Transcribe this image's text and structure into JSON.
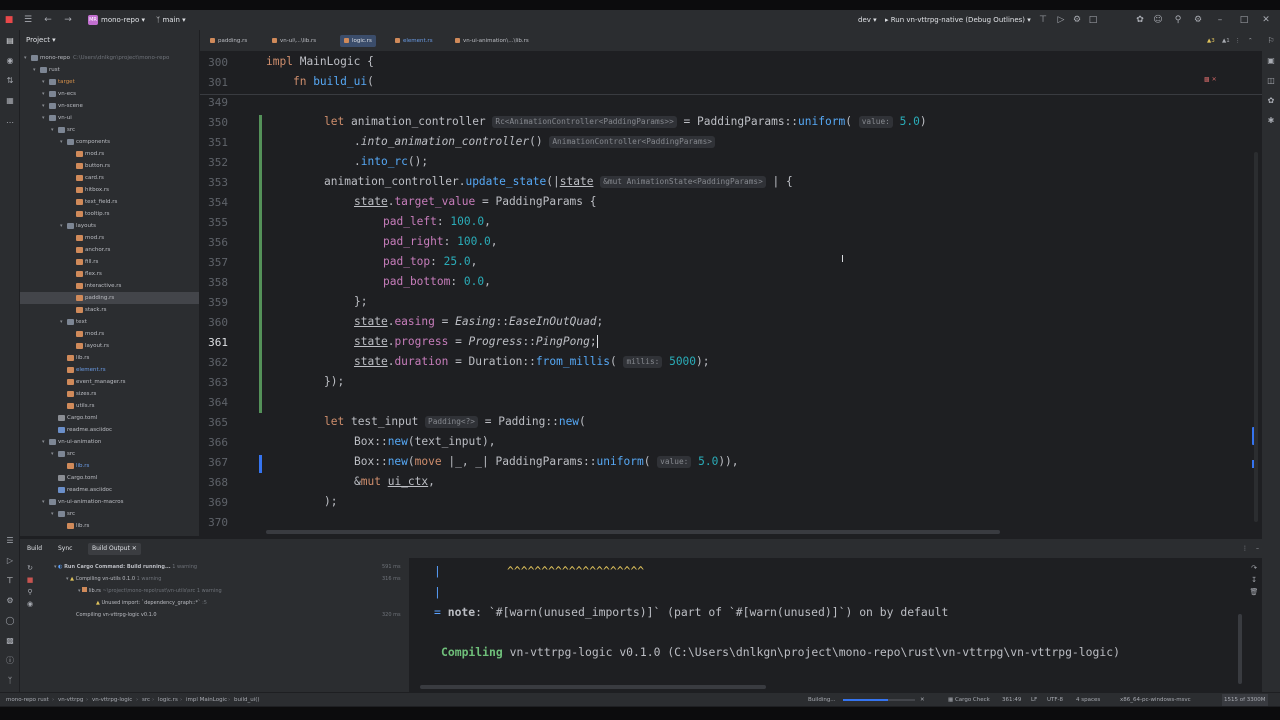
{
  "titlebar": {
    "project_badge": "MR",
    "project_name": "mono-repo",
    "branch": "main",
    "profile": "dev",
    "run_config": "Run vn-vttrpg-native (Debug Outlines)"
  },
  "project_panel": {
    "title": "Project",
    "rows": [
      {
        "label": "mono-repo",
        "path": "C:\\Users\\dnlkgn\\project\\mono-repo",
        "depth": 0,
        "kind": "folder",
        "style": ""
      },
      {
        "label": "rust",
        "depth": 1,
        "kind": "folder",
        "style": ""
      },
      {
        "label": "target",
        "depth": 2,
        "kind": "folder",
        "style": "orange"
      },
      {
        "label": "vn-ecs",
        "depth": 2,
        "kind": "folder",
        "style": ""
      },
      {
        "label": "vn-scene",
        "depth": 2,
        "kind": "folder",
        "style": ""
      },
      {
        "label": "vn-ui",
        "depth": 2,
        "kind": "folder",
        "style": ""
      },
      {
        "label": "src",
        "depth": 3,
        "kind": "folder",
        "style": ""
      },
      {
        "label": "components",
        "depth": 4,
        "kind": "folder",
        "style": ""
      },
      {
        "label": "mod.rs",
        "depth": 5,
        "kind": "rs",
        "style": ""
      },
      {
        "label": "button.rs",
        "depth": 5,
        "kind": "rs",
        "style": ""
      },
      {
        "label": "card.rs",
        "depth": 5,
        "kind": "rs",
        "style": ""
      },
      {
        "label": "hitbox.rs",
        "depth": 5,
        "kind": "rs",
        "style": ""
      },
      {
        "label": "text_field.rs",
        "depth": 5,
        "kind": "rs",
        "style": ""
      },
      {
        "label": "tooltip.rs",
        "depth": 5,
        "kind": "rs",
        "style": ""
      },
      {
        "label": "layouts",
        "depth": 4,
        "kind": "folder",
        "style": ""
      },
      {
        "label": "mod.rs",
        "depth": 5,
        "kind": "rs",
        "style": ""
      },
      {
        "label": "anchor.rs",
        "depth": 5,
        "kind": "rs",
        "style": ""
      },
      {
        "label": "fill.rs",
        "depth": 5,
        "kind": "rs",
        "style": ""
      },
      {
        "label": "flex.rs",
        "depth": 5,
        "kind": "rs",
        "style": ""
      },
      {
        "label": "interactive.rs",
        "depth": 5,
        "kind": "rs",
        "style": ""
      },
      {
        "label": "padding.rs",
        "depth": 5,
        "kind": "rs",
        "style": "sel"
      },
      {
        "label": "stack.rs",
        "depth": 5,
        "kind": "rs",
        "style": ""
      },
      {
        "label": "text",
        "depth": 4,
        "kind": "folder",
        "style": ""
      },
      {
        "label": "mod.rs",
        "depth": 5,
        "kind": "rs",
        "style": ""
      },
      {
        "label": "layout.rs",
        "depth": 5,
        "kind": "rs",
        "style": ""
      },
      {
        "label": "lib.rs",
        "depth": 4,
        "kind": "rs",
        "style": ""
      },
      {
        "label": "element.rs",
        "depth": 4,
        "kind": "rs",
        "style": "blue"
      },
      {
        "label": "event_manager.rs",
        "depth": 4,
        "kind": "rs",
        "style": ""
      },
      {
        "label": "sizes.rs",
        "depth": 4,
        "kind": "rs",
        "style": ""
      },
      {
        "label": "utils.rs",
        "depth": 4,
        "kind": "rs",
        "style": ""
      },
      {
        "label": "Cargo.toml",
        "depth": 3,
        "kind": "toml",
        "style": ""
      },
      {
        "label": "readme.asciidoc",
        "depth": 3,
        "kind": "doc",
        "style": ""
      },
      {
        "label": "vn-ui-animation",
        "depth": 2,
        "kind": "folder",
        "style": ""
      },
      {
        "label": "src",
        "depth": 3,
        "kind": "folder",
        "style": ""
      },
      {
        "label": "lib.rs",
        "depth": 4,
        "kind": "rs",
        "style": "blue"
      },
      {
        "label": "Cargo.toml",
        "depth": 3,
        "kind": "toml",
        "style": ""
      },
      {
        "label": "readme.asciidoc",
        "depth": 3,
        "kind": "doc",
        "style": ""
      },
      {
        "label": "vn-ui-animation-macros",
        "depth": 2,
        "kind": "folder",
        "style": ""
      },
      {
        "label": "src",
        "depth": 3,
        "kind": "folder",
        "style": ""
      },
      {
        "label": "lib.rs",
        "depth": 4,
        "kind": "rs",
        "style": ""
      }
    ]
  },
  "tabs": [
    {
      "label": "padding.rs",
      "active": false,
      "style": ""
    },
    {
      "label": "vn-ui\\...\\lib.rs",
      "active": false,
      "style": ""
    },
    {
      "label": "logic.rs",
      "active": true,
      "style": ""
    },
    {
      "label": "element.rs",
      "active": false,
      "style": "blue"
    },
    {
      "label": "vn-ui-animation\\...\\lib.rs",
      "active": false,
      "style": ""
    }
  ],
  "editor": {
    "inspection_count": "3",
    "inspection_count2": "1",
    "current_line": "361",
    "sticky": [
      {
        "num": "300",
        "code": "impl MainLogic {"
      },
      {
        "num": "301",
        "code": "    fn build_ui("
      }
    ],
    "line_numbers": [
      "349",
      "350",
      "351",
      "352",
      "353",
      "354",
      "355",
      "356",
      "357",
      "358",
      "359",
      "360",
      "361",
      "362",
      "363",
      "364",
      "365",
      "366",
      "367",
      "368",
      "369",
      "370"
    ],
    "hints": {
      "h350": "Rc<AnimationController<PaddingParams>>",
      "h350v": "value:",
      "h351": "AnimationController<PaddingParams>",
      "h353": "&mut AnimationState<PaddingParams>",
      "h362": "millis:",
      "h365": "Padding<?>",
      "h367": "value:"
    }
  },
  "build": {
    "tabs": [
      "Build",
      "Sync",
      "Build Output"
    ],
    "tree": [
      {
        "label": "Run Cargo Command: Build running...",
        "extra": "1 warning",
        "time": "591 ms"
      },
      {
        "label": "Compiling vn-utils 0.1.0",
        "extra": "1 warning",
        "time": "316 ms"
      },
      {
        "label": "lib.rs",
        "extra": "~\\project\\mono-repo\\rust\\vn-utils\\src  1 warning",
        "time": ""
      },
      {
        "label": "Unused import: `dependency_graph::*`",
        "extra": ":5",
        "time": ""
      },
      {
        "label": "Compiling vn-vttrpg-logic v0.1.0",
        "extra": "",
        "time": "320 ms"
      }
    ],
    "output": {
      "carets": "^^^^^^^^^^^^^^^^^^^^",
      "pipe": "|",
      "note_eq": "=",
      "note_word": "note",
      "note_rest": ": `#[warn(unused_imports)]` (part of `#[warn(unused)]`) on by default",
      "compiling_word": "Compiling",
      "compiling_rest": " vn-vttrpg-logic v0.1.0 (C:\\Users\\dnlkgn\\project\\mono-repo\\rust\\vn-vttrpg\\vn-vttrpg-logic)"
    }
  },
  "status": {
    "breadcrumbs": [
      "mono-repo",
      "rust",
      "vn-vttrpg",
      "vn-vttrpg-logic",
      "src",
      "logic.rs",
      "impl MainLogic",
      "build_ui()"
    ],
    "building": "Building...",
    "progress": 0.62,
    "cargo_check": "Cargo Check",
    "position": "361:49",
    "line_sep": "LF",
    "encoding": "UTF-8",
    "indent": "4 spaces",
    "target": "x86_64-pc-windows-msvc",
    "memory": "1515 of 3300M"
  },
  "colors": {
    "accent": "#3574f0",
    "added": "#549159"
  }
}
